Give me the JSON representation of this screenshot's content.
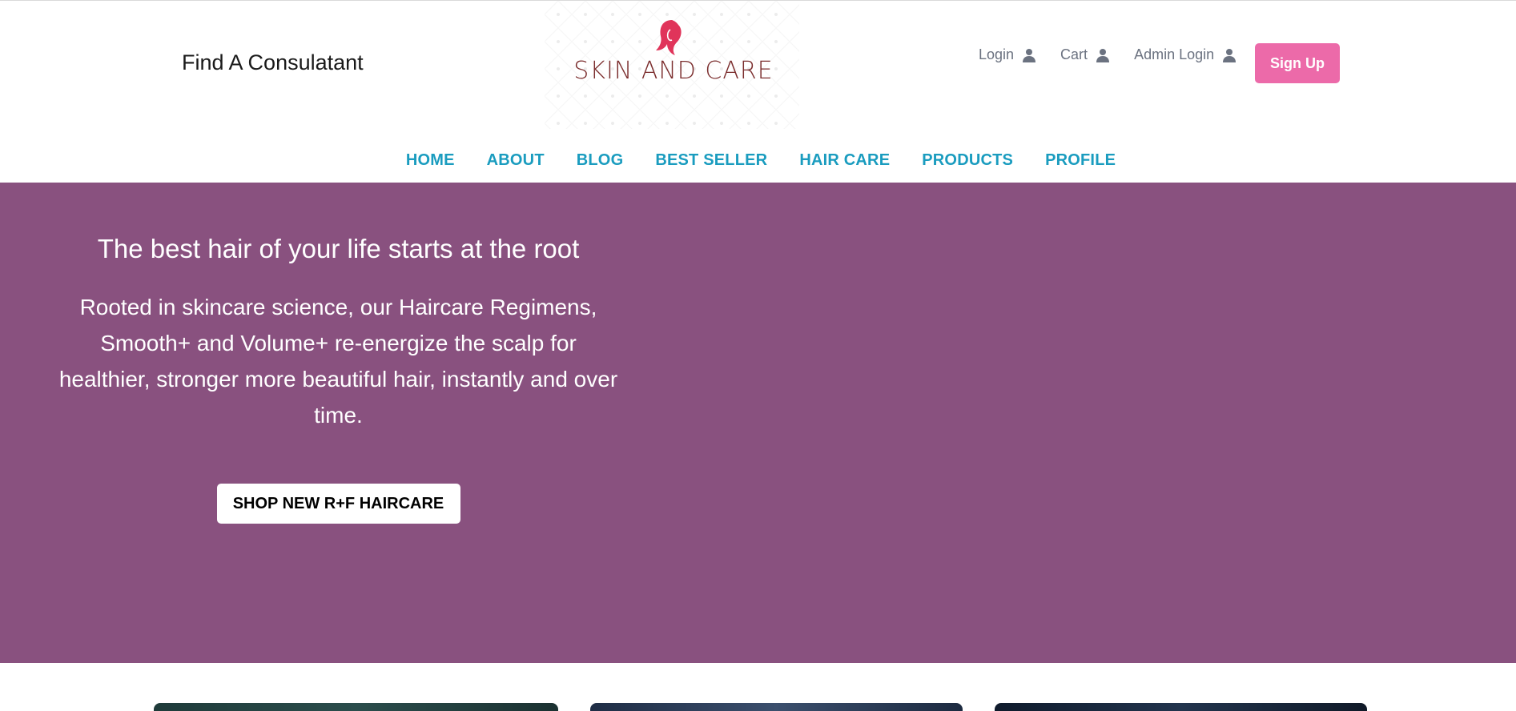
{
  "header": {
    "find_consultant": "Find A Consulatant",
    "logo_text": "SKIN AND CARE",
    "user_links": [
      {
        "label": "Login",
        "icon": "user-icon"
      },
      {
        "label": "Cart",
        "icon": "user-icon"
      },
      {
        "label": "Admin Login",
        "icon": "user-icon"
      }
    ],
    "signup_label": "Sign Up"
  },
  "nav": {
    "items": [
      "HOME",
      "ABOUT",
      "BLOG",
      "BEST SELLER",
      "HAIR CARE",
      "PRODUCTS",
      "PROFILE"
    ]
  },
  "hero": {
    "title": "The best hair of your life starts at the root",
    "text": "Rooted in skincare science, our Haircare Regimens, Smooth+ and Volume+ re-energize the scalp for healthier, stronger more beautiful hair, instantly and over time.",
    "button_label": "SHOP NEW R+F HAIRCARE"
  },
  "colors": {
    "hero_bg": "#89517f",
    "nav_link": "#1a9cbf",
    "signup_bg": "#ec6aa9",
    "logo_text": "#7b2d2d",
    "logo_mark": "#e0345a"
  }
}
